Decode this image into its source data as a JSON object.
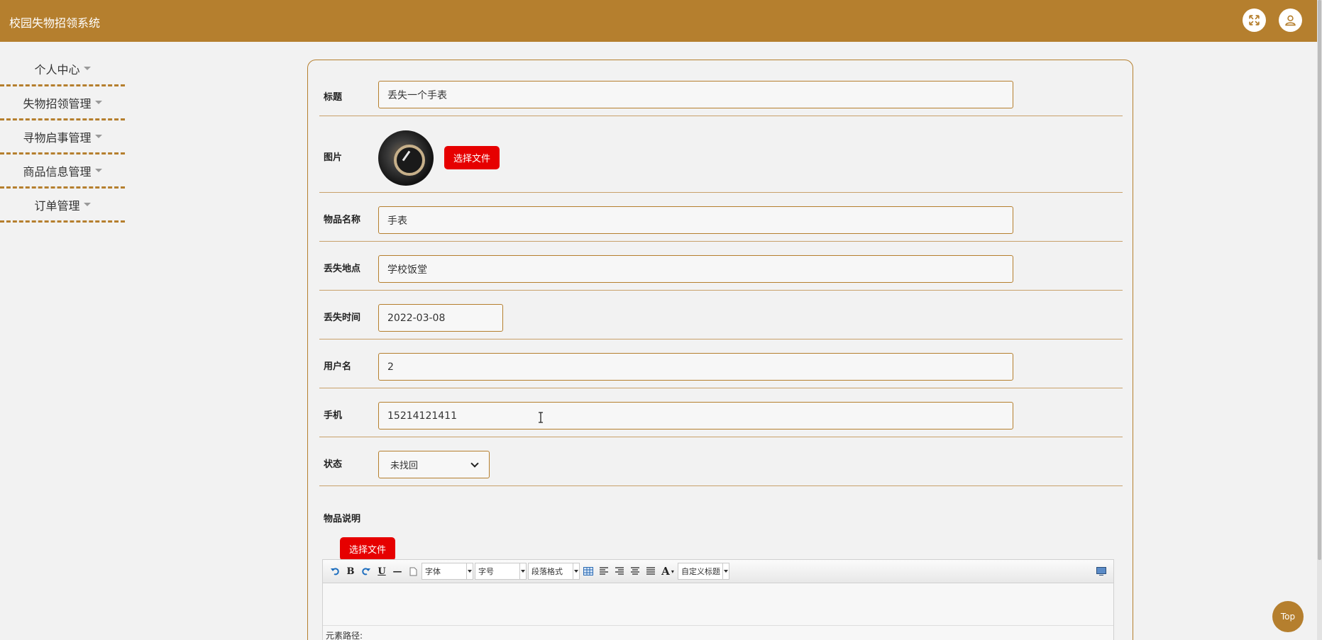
{
  "header": {
    "app_title": "校园失物招领系统",
    "icons": [
      "fullscreen-icon",
      "user-icon"
    ]
  },
  "sidebar": {
    "items": [
      {
        "label": "个人中心"
      },
      {
        "label": "失物招领管理"
      },
      {
        "label": "寻物启事管理"
      },
      {
        "label": "商品信息管理"
      },
      {
        "label": "订单管理"
      }
    ]
  },
  "form": {
    "title": {
      "label": "标题",
      "value": "丢失一个手表"
    },
    "image": {
      "label": "图片",
      "button": "选择文件"
    },
    "item_name": {
      "label": "物品名称",
      "value": "手表"
    },
    "lost_place": {
      "label": "丢失地点",
      "value": "学校饭堂"
    },
    "lost_time": {
      "label": "丢失时间",
      "value": "2022-03-08"
    },
    "username": {
      "label": "用户名",
      "value": "2"
    },
    "phone": {
      "label": "手机",
      "value": "15214121411"
    },
    "status": {
      "label": "状态",
      "value": "未找回"
    },
    "description": {
      "label": "物品说明",
      "button": "选择文件"
    }
  },
  "editor": {
    "font_combo": "字体",
    "size_combo": "字号",
    "paragraph_combo": "段落格式",
    "custom_title_combo": "自定义标题",
    "path_label": "元素路径:"
  },
  "top_button": "Top",
  "colors": {
    "primary": "#b57f2e",
    "danger": "#e60000",
    "background": "#f2f2f2"
  }
}
